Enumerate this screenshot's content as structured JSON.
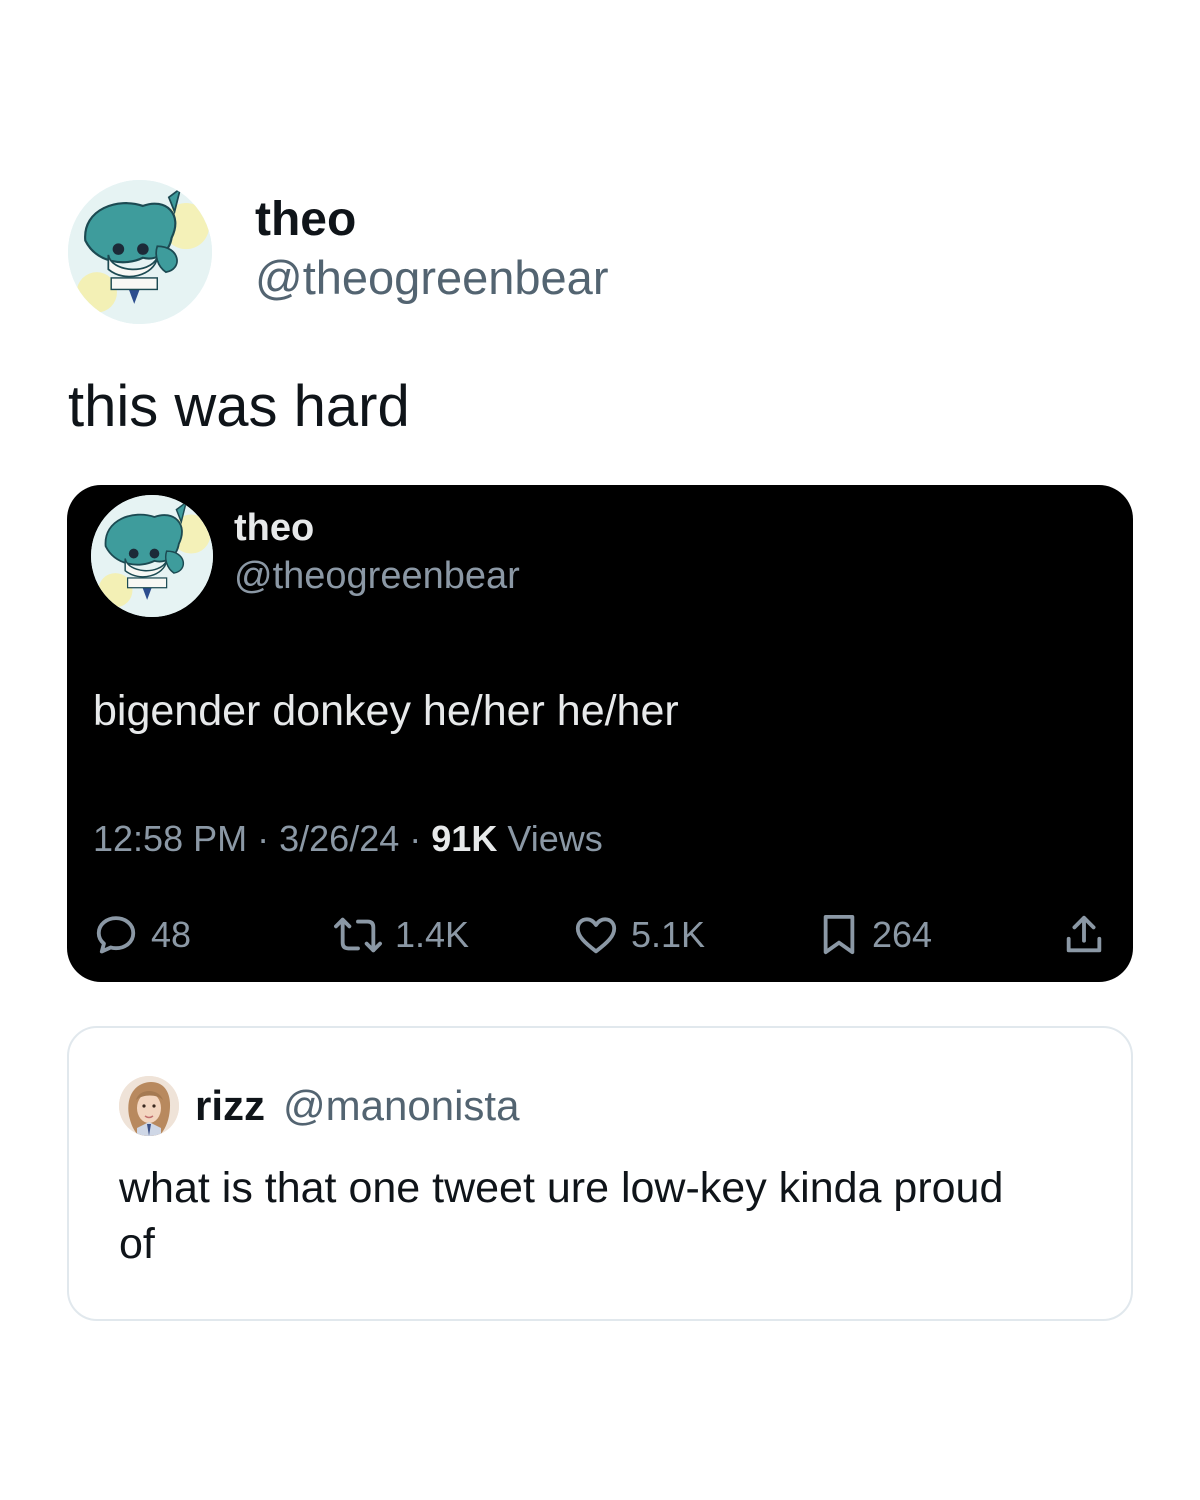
{
  "main_tweet": {
    "author": {
      "display_name": "theo",
      "handle": "@theogreenbear",
      "avatar_icon": "cartoon-character-avatar"
    },
    "text": "this was hard"
  },
  "embedded_tweet": {
    "author": {
      "display_name": "theo",
      "handle": "@theogreenbear",
      "avatar_icon": "cartoon-character-avatar"
    },
    "text": "bigender donkey he/her he/her",
    "time": "12:58 PM",
    "date": "3/26/24",
    "separator": "·",
    "views_count": "91K",
    "views_label": "Views",
    "stats": {
      "replies": "48",
      "reposts": "1.4K",
      "likes": "5.1K",
      "bookmarks": "264"
    },
    "icons": [
      "reply-icon",
      "repost-icon",
      "like-icon",
      "bookmark-icon",
      "share-icon"
    ]
  },
  "quoted_tweet": {
    "author": {
      "display_name": "rizz",
      "handle": "@manonista",
      "avatar_icon": "profile-photo-avatar"
    },
    "text": "what is that one tweet ure low-key kinda proud of"
  },
  "colors": {
    "text_primary": "#0f1419",
    "text_secondary": "#536471",
    "dark_card_bg": "#000000",
    "dark_text": "#e7e9ea",
    "dark_secondary": "#8b98a5",
    "quote_border": "#e1e8ed"
  }
}
